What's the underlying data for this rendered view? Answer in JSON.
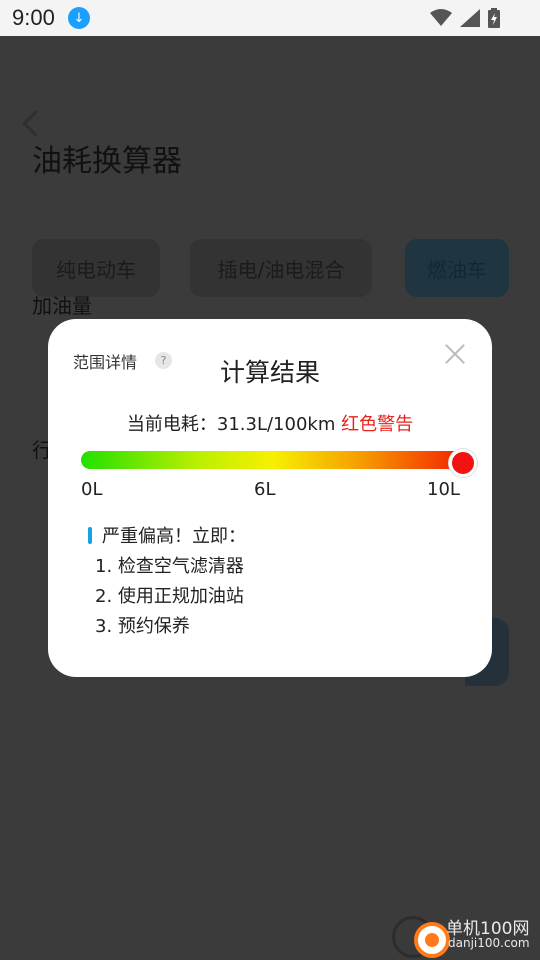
{
  "status_bar": {
    "time": "9:00",
    "icons": [
      "download-icon",
      "wifi-icon",
      "signal-icon",
      "battery-icon"
    ]
  },
  "background": {
    "page_title": "油耗换算器",
    "tabs": [
      {
        "label": "纯电动车"
      },
      {
        "label": "插电/油电混合"
      },
      {
        "label": "燃油车",
        "selected": true
      }
    ],
    "field_label_1": "加油量",
    "field_label_2_partial": "行"
  },
  "modal": {
    "range_details_label": "范围详情",
    "help_glyph": "?",
    "title": "计算结果",
    "current_prefix": "当前电耗：31.3L/100km",
    "warning_text": "红色警告",
    "gauge": {
      "ticks": [
        "0L",
        "6L",
        "10L"
      ],
      "value_fraction": 1.0,
      "colors": {
        "start": "#22e000",
        "mid": "#f7f000",
        "end": "#f32000"
      }
    },
    "advice_heading": "严重偏高！立即：",
    "advice_steps": [
      "1. 检查空气滤清器",
      "2. 使用正规加油站",
      "3. 预约保养"
    ]
  },
  "watermark": {
    "title": "单机100网",
    "url": "danji100.com"
  },
  "colors": {
    "accent_blue": "#16a2e0",
    "warning_red": "#e8231b"
  }
}
